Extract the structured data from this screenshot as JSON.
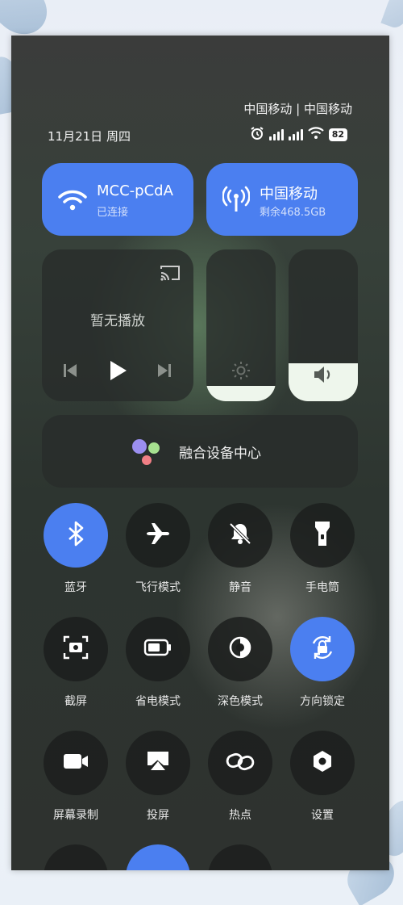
{
  "status": {
    "carriers": "中国移动 | 中国移动",
    "date": "11月21日 周四",
    "battery": "82"
  },
  "wifi_tile": {
    "name": "MCC-pCdA",
    "status": "已连接"
  },
  "mobile_tile": {
    "name": "中国移动",
    "remaining": "剩余468.5GB"
  },
  "media": {
    "status": "暂无播放"
  },
  "sliders": {
    "brightness_level": 0.1,
    "volume_level": 0.25
  },
  "device_center": {
    "label": "融合设备中心"
  },
  "toggles": [
    {
      "label": "蓝牙",
      "icon": "bluetooth-icon",
      "on": true
    },
    {
      "label": "飞行模式",
      "icon": "airplane-icon",
      "on": false
    },
    {
      "label": "静音",
      "icon": "bell-off-icon",
      "on": false
    },
    {
      "label": "手电筒",
      "icon": "flashlight-icon",
      "on": false
    },
    {
      "label": "截屏",
      "icon": "screenshot-icon",
      "on": false
    },
    {
      "label": "省电模式",
      "icon": "battery-icon",
      "on": false
    },
    {
      "label": "深色模式",
      "icon": "dark-mode-icon",
      "on": false
    },
    {
      "label": "方向锁定",
      "icon": "rotation-lock-icon",
      "on": true
    },
    {
      "label": "屏幕录制",
      "icon": "video-camera-icon",
      "on": false
    },
    {
      "label": "投屏",
      "icon": "cast-screen-icon",
      "on": false
    },
    {
      "label": "热点",
      "icon": "hotspot-link-icon",
      "on": false
    },
    {
      "label": "设置",
      "icon": "settings-icon",
      "on": false
    }
  ],
  "colors": {
    "accent": "#4b7ff0",
    "tile_dark": "#2c302e"
  }
}
